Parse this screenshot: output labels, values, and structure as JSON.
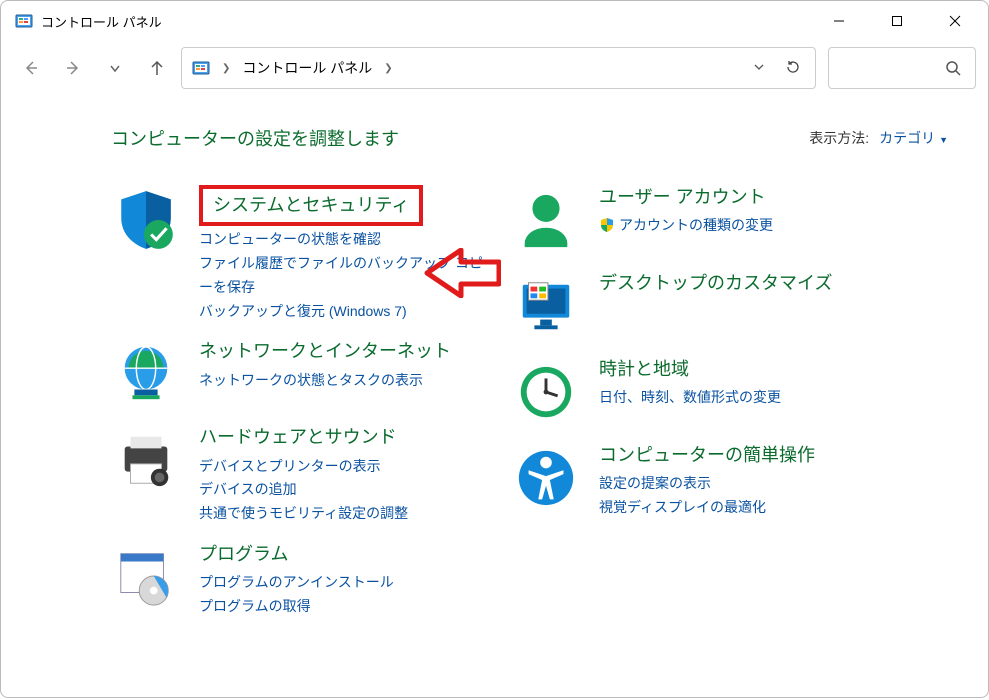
{
  "window": {
    "title": "コントロール パネル"
  },
  "breadcrumb": {
    "current": "コントロール パネル"
  },
  "heading": "コンピューターの設定を調整します",
  "viewBy": {
    "label": "表示方法:",
    "value": "カテゴリ"
  },
  "categories": {
    "system": {
      "title": "システムとセキュリティ",
      "links": [
        "コンピューターの状態を確認",
        "ファイル履歴でファイルのバックアップ コピーを保存",
        "バックアップと復元 (Windows 7)"
      ]
    },
    "network": {
      "title": "ネットワークとインターネット",
      "links": [
        "ネットワークの状態とタスクの表示"
      ]
    },
    "hardware": {
      "title": "ハードウェアとサウンド",
      "links": [
        "デバイスとプリンターの表示",
        "デバイスの追加",
        "共通で使うモビリティ設定の調整"
      ]
    },
    "programs": {
      "title": "プログラム",
      "links": [
        "プログラムのアンインストール",
        "プログラムの取得"
      ]
    },
    "users": {
      "title": "ユーザー アカウント",
      "links": [
        "アカウントの種類の変更"
      ]
    },
    "appearance": {
      "title": "デスクトップのカスタマイズ",
      "links": []
    },
    "clock": {
      "title": "時計と地域",
      "links": [
        "日付、時刻、数値形式の変更"
      ]
    },
    "ease": {
      "title": "コンピューターの簡単操作",
      "links": [
        "設定の提案の表示",
        "視覚ディスプレイの最適化"
      ]
    }
  }
}
